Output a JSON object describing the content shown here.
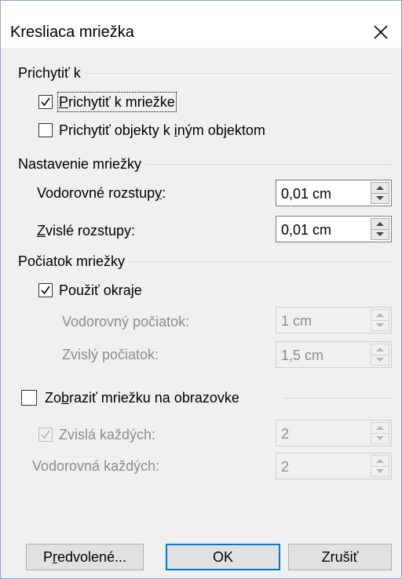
{
  "dialog": {
    "title": "Kresliaca mriežka",
    "close_icon": "close-icon"
  },
  "snap": {
    "group_label": "Prichytiť k",
    "snap_to_grid": {
      "label_pre": "",
      "label_key": "P",
      "label_post": "richytiť k mriežke",
      "checked": true
    },
    "snap_to_objects": {
      "label_pre": "Prichytiť objekty k ",
      "label_key": "i",
      "label_post": "ným objektom",
      "checked": false
    }
  },
  "grid_settings": {
    "group_label": "Nastavenie mriežky",
    "horizontal": {
      "label_pre": "Vodorovné rozstup",
      "label_key": "y",
      "label_post": ":",
      "value": "0,01 cm"
    },
    "vertical": {
      "label_pre": "",
      "label_key": "Z",
      "label_post": "vislé rozstupy:",
      "value": "0,01 cm"
    }
  },
  "grid_origin": {
    "group_label": "Počiatok mriežky",
    "use_margins": {
      "label_pre": "Použiť okra",
      "label_key": "j",
      "label_post": "e",
      "checked": true
    },
    "horizontal_origin": {
      "label": "Vodorovný počiatok:",
      "value": "1 cm"
    },
    "vertical_origin": {
      "label": "Zvislý počiatok:",
      "value": "1,5 cm"
    }
  },
  "display": {
    "show_grid": {
      "label_pre": "Zo",
      "label_key": "b",
      "label_post": "raziť mriežku na obrazovke",
      "checked": false
    },
    "vertical_every": {
      "label": "Zvislá každých:",
      "value": "2",
      "checked": true
    },
    "horizontal_every": {
      "label": "Vodorovná každých:",
      "value": "2"
    }
  },
  "buttons": {
    "defaults": {
      "label_pre": "P",
      "label_key": "r",
      "label_post": "edvolené..."
    },
    "ok": "OK",
    "cancel": "Zrušiť"
  },
  "colors": {
    "accent": "#0078d7",
    "client_bg": "#f0f0f0",
    "disabled_text": "#8c8c8c"
  }
}
